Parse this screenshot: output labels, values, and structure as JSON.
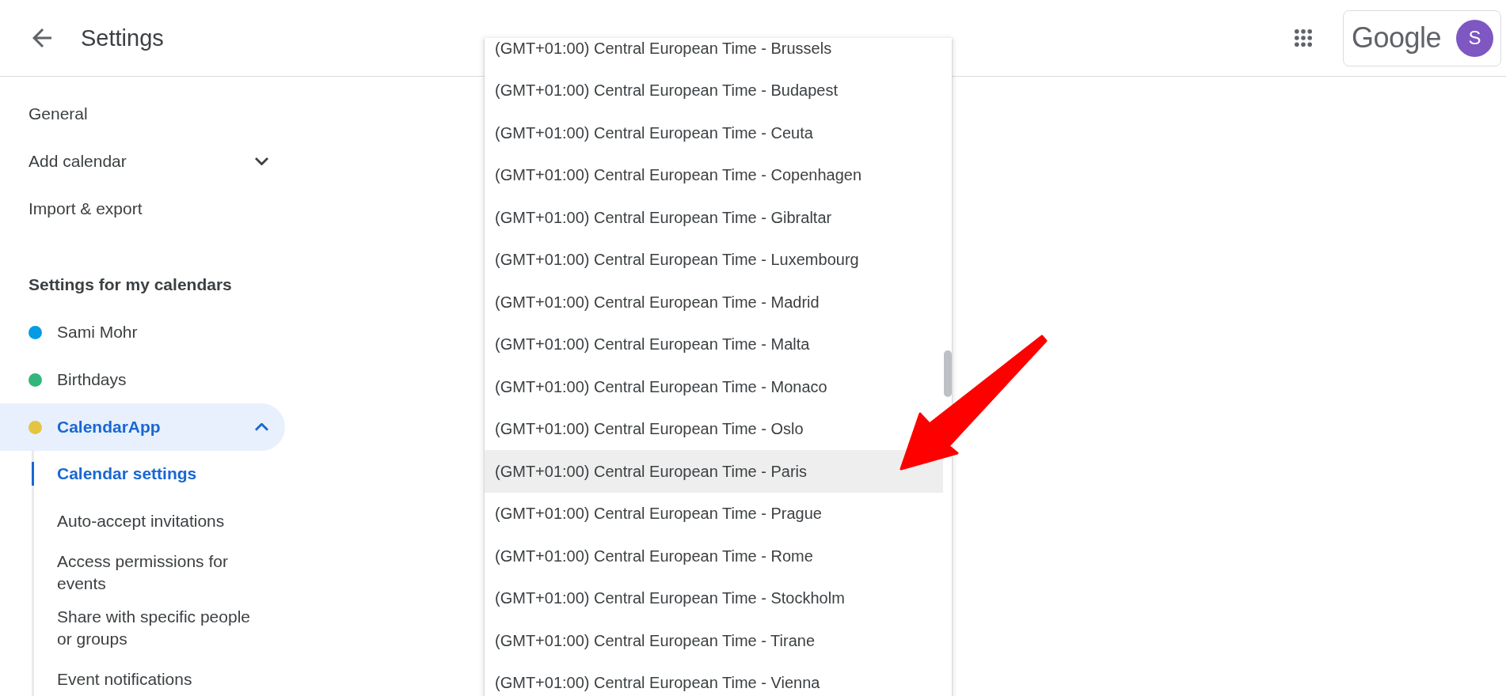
{
  "header": {
    "title": "Settings",
    "logo": "Google",
    "avatar_initial": "S"
  },
  "sidebar": {
    "items": [
      {
        "label": "General"
      },
      {
        "label": "Add calendar",
        "expanded": false
      },
      {
        "label": "Import & export"
      }
    ],
    "section_title": "Settings for my calendars",
    "calendars": [
      {
        "name": "Sami Mohr",
        "color": "#039be5",
        "selected": false
      },
      {
        "name": "Birthdays",
        "color": "#33b679",
        "selected": false
      },
      {
        "name": "CalendarApp",
        "color": "#e4c441",
        "selected": true,
        "expanded": true,
        "children": [
          {
            "label": "Calendar settings",
            "selected": true
          },
          {
            "label": "Auto-accept invitations",
            "selected": false
          },
          {
            "label": "Access permissions for events",
            "selected": false
          },
          {
            "label": "Share with specific people or groups",
            "selected": false
          },
          {
            "label": "Event notifications",
            "selected": false
          }
        ]
      }
    ]
  },
  "timezone_menu": {
    "options": [
      {
        "label": "(GMT+01:00) Central European Time - Brussels",
        "selected": false
      },
      {
        "label": "(GMT+01:00) Central European Time - Budapest",
        "selected": false
      },
      {
        "label": "(GMT+01:00) Central European Time - Ceuta",
        "selected": false
      },
      {
        "label": "(GMT+01:00) Central European Time - Copenhagen",
        "selected": false
      },
      {
        "label": "(GMT+01:00) Central European Time - Gibraltar",
        "selected": false
      },
      {
        "label": "(GMT+01:00) Central European Time - Luxembourg",
        "selected": false
      },
      {
        "label": "(GMT+01:00) Central European Time - Madrid",
        "selected": false
      },
      {
        "label": "(GMT+01:00) Central European Time - Malta",
        "selected": false
      },
      {
        "label": "(GMT+01:00) Central European Time - Monaco",
        "selected": false
      },
      {
        "label": "(GMT+01:00) Central European Time - Oslo",
        "selected": false
      },
      {
        "label": "(GMT+01:00) Central European Time - Paris",
        "selected": true
      },
      {
        "label": "(GMT+01:00) Central European Time - Prague",
        "selected": false
      },
      {
        "label": "(GMT+01:00) Central European Time - Rome",
        "selected": false
      },
      {
        "label": "(GMT+01:00) Central European Time - Stockholm",
        "selected": false
      },
      {
        "label": "(GMT+01:00) Central European Time - Tirane",
        "selected": false
      },
      {
        "label": "(GMT+01:00) Central European Time - Vienna",
        "selected": false
      }
    ]
  }
}
